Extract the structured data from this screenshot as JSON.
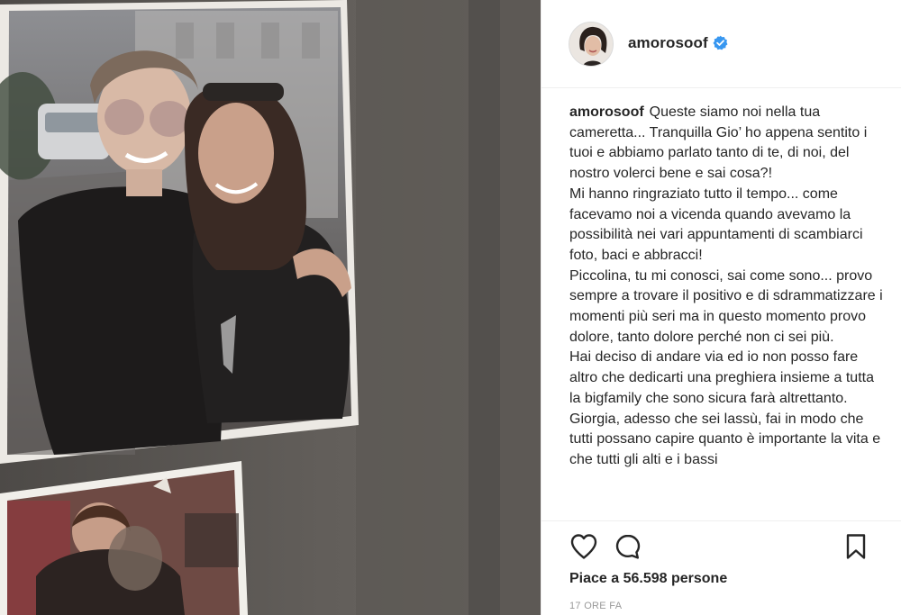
{
  "post": {
    "username": "amorosoof",
    "verified": true,
    "caption": {
      "username": "amorosoof",
      "text": "Queste siamo noi nella tua cameretta... Tranquilla Gio’ ho appena sentito i tuoi e abbiamo parlato tanto di te, di noi, del nostro volerci bene e sai cosa?!\nMi hanno ringraziato tutto il tempo... come facevamo noi a vicenda quando avevamo la possibilità nei vari appuntamenti di scambiarci foto, baci e abbracci!\nPiccolina, tu mi conosci, sai come sono... provo sempre a trovare il positivo e di sdrammatizzare i momenti più seri ma in questo momento provo dolore, tanto dolore perché non ci sei più.\nHai deciso di andare via ed io non posso fare altro che dedicarti una preghiera insieme a tutta la bigfamily che sono sicura farà altrettanto.\nGiorgia, adesso che sei lassù, fai in modo che tutti possano capire quanto è importante la vita e che tutti gli alti e i bassi"
    },
    "likes": "Piace a 56.598 persone",
    "timestamp": "17 ORE FA"
  },
  "icons": {
    "like": "heart-outline-icon",
    "comment": "comment-bubble-icon",
    "save": "bookmark-outline-icon",
    "verified": "verified-badge-icon"
  },
  "colors": {
    "verified_badge": "#3897f0",
    "text": "#262626",
    "muted": "#999999",
    "divider": "#efefef"
  }
}
